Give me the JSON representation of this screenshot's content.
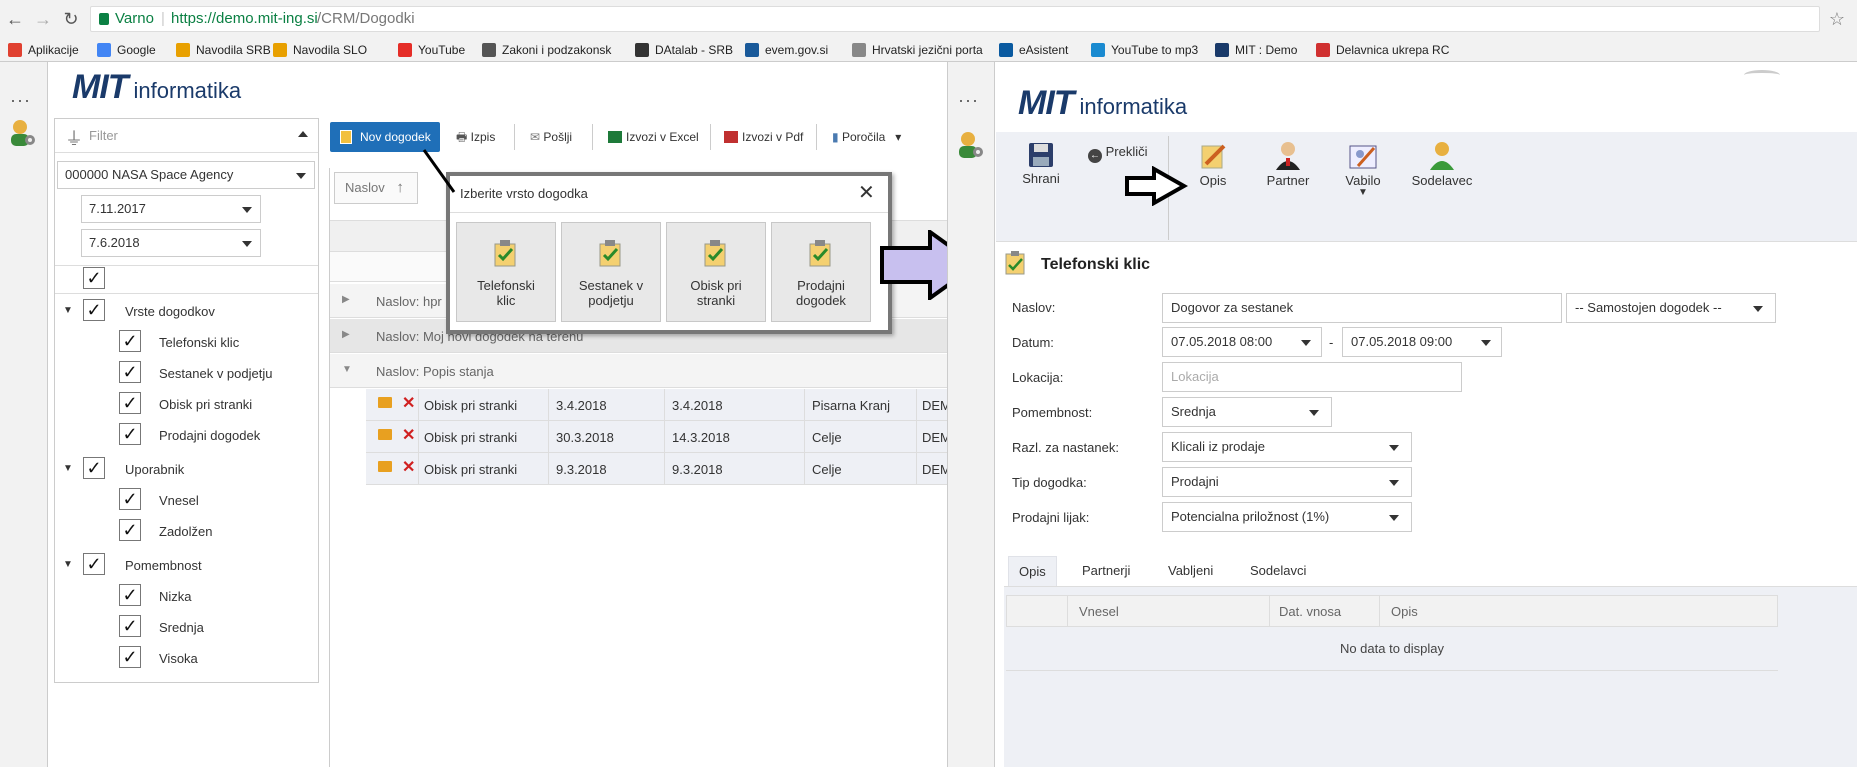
{
  "browser": {
    "secure_label": "Varno",
    "url_host": "https://demo.mit-ing.si",
    "url_path": "/CRM/Dogodki",
    "bookmarks": [
      {
        "label": "Aplikacije",
        "color": "#e04030"
      },
      {
        "label": "Google",
        "color": "#4285f4"
      },
      {
        "label": "Navodila SRB",
        "color": "#e8a000"
      },
      {
        "label": "Navodila SLO",
        "color": "#e8a000"
      },
      {
        "label": "YouTube",
        "color": "#e52d27"
      },
      {
        "label": "Zakoni i podzakonsk",
        "color": "#555"
      },
      {
        "label": "DAtalab - SRB",
        "color": "#333"
      },
      {
        "label": "evem.gov.si",
        "color": "#1a5a9a"
      },
      {
        "label": "Hrvatski jezični porta",
        "color": "#888"
      },
      {
        "label": "eAsistent",
        "color": "#0a5aa0"
      },
      {
        "label": "YouTube to mp3",
        "color": "#1a8ad0"
      },
      {
        "label": "MIT : Demo",
        "color": "#1a3a6a"
      },
      {
        "label": "Delavnica ukrepa RC",
        "color": "#d03030"
      }
    ]
  },
  "logo": {
    "mit": "MIT",
    "informatika": "informatika"
  },
  "filter": {
    "placeholder": "Filter",
    "company": "000000 NASA Space Agency",
    "date_from": "7.11.2017",
    "date_to": "7.6.2018",
    "tree": {
      "vrste": {
        "label": "Vrste dogodkov",
        "items": [
          "Telefonski klic",
          "Sestanek v podjetju",
          "Obisk pri stranki",
          "Prodajni dogodek"
        ]
      },
      "uporabnik": {
        "label": "Uporabnik",
        "items": [
          "Vnesel",
          "Zadolžen"
        ]
      },
      "pomembnost": {
        "label": "Pomembnost",
        "items": [
          "Nizka",
          "Srednja",
          "Visoka"
        ]
      }
    }
  },
  "toolbar": {
    "new_event": "Nov dogodek",
    "print": "Izpis",
    "send": "Pošlji",
    "export_excel": "Izvozi v Excel",
    "export_pdf": "Izvozi v Pdf",
    "reports": "Poročila"
  },
  "grid": {
    "sort_column": "Naslov",
    "groups": [
      {
        "label": "Naslov: hpr"
      },
      {
        "label": "Naslov: Moj novi dogodek na terenu"
      },
      {
        "label": "Naslov: Popis stanja"
      }
    ],
    "rows": [
      {
        "type": "Obisk pri stranki",
        "d1": "3.4.2018",
        "d2": "3.4.2018",
        "loc": "Pisarna Kranj",
        "user": "DEM"
      },
      {
        "type": "Obisk pri stranki",
        "d1": "30.3.2018",
        "d2": "14.3.2018",
        "loc": "Celje",
        "user": "DEM"
      },
      {
        "type": "Obisk pri stranki",
        "d1": "9.3.2018",
        "d2": "9.3.2018",
        "loc": "Celje",
        "user": "DEM"
      }
    ]
  },
  "popup": {
    "title": "Izberite vrsto dogodka",
    "tiles": [
      {
        "label1": "Telefonski",
        "label2": "klic"
      },
      {
        "label1": "Sestanek v",
        "label2": "podjetju"
      },
      {
        "label1": "Obisk pri",
        "label2": "stranki"
      },
      {
        "label1": "Prodajni",
        "label2": "dogodek"
      }
    ]
  },
  "detail": {
    "ribbon": {
      "save": "Shrani",
      "cancel": "Prekliči",
      "desc": "Opis",
      "partner": "Partner",
      "invite": "Vabilo",
      "coworker": "Sodelavec"
    },
    "title": "Telefonski klic",
    "form": {
      "naslov_label": "Naslov:",
      "naslov_value": "Dogovor za sestanek",
      "samostojen": "-- Samostojen dogodek --",
      "datum_label": "Datum:",
      "datum_from": "07.05.2018 08:00",
      "datum_sep": "-",
      "datum_to": "07.05.2018 09:00",
      "lokacija_label": "Lokacija:",
      "lokacija_placeholder": "Lokacija",
      "pomembnost_label": "Pomembnost:",
      "pomembnost_value": "Srednja",
      "razl_label": "Razl. za nastanek:",
      "razl_value": "Klicali iz prodaje",
      "tip_label": "Tip dogodka:",
      "tip_value": "Prodajni",
      "lijak_label": "Prodajni lijak:",
      "lijak_value": "Potencialna priložnost (1%)"
    },
    "tabs": [
      "Opis",
      "Partnerji",
      "Vabljeni",
      "Sodelavci"
    ],
    "table": {
      "columns": [
        "Vnesel",
        "Dat. vnosa",
        "Opis"
      ],
      "empty": "No data to display"
    }
  }
}
